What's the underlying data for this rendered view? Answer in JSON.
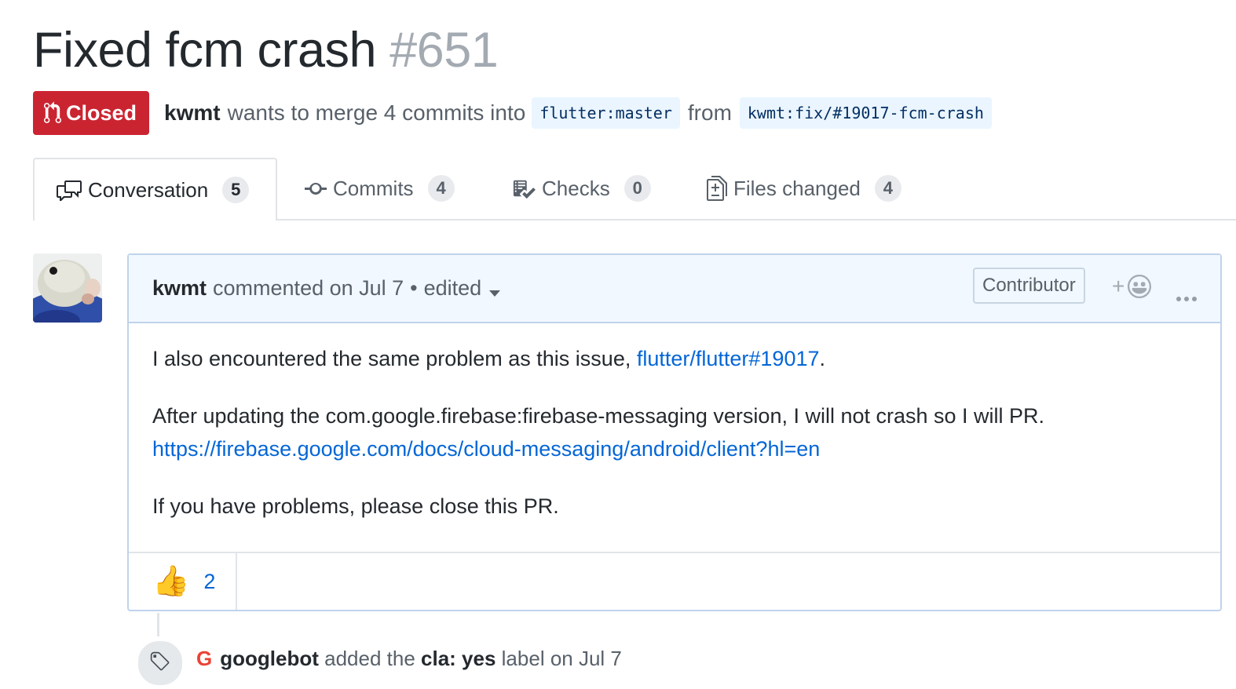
{
  "pr": {
    "title": "Fixed fcm crash",
    "number": "#651",
    "state": "Closed",
    "author": "kwmt",
    "merge_text": "wants to merge 4 commits into",
    "base_branch": "flutter:master",
    "from_word": "from",
    "head_branch": "kwmt:fix/#19017-fcm-crash"
  },
  "tabs": [
    {
      "label": "Conversation",
      "count": "5",
      "icon": "comment-discussion-icon"
    },
    {
      "label": "Commits",
      "count": "4",
      "icon": "git-commit-icon"
    },
    {
      "label": "Checks",
      "count": "0",
      "icon": "checklist-icon"
    },
    {
      "label": "Files changed",
      "count": "4",
      "icon": "diff-icon"
    }
  ],
  "comment": {
    "author": "kwmt",
    "commented_text": "commented on Jul 7",
    "separator": "•",
    "edited_label": "edited",
    "badge": "Contributor",
    "add_reaction": "+",
    "body": {
      "p1_text": "I also encountered the same problem as this issue, ",
      "p1_link": "flutter/flutter#19017",
      "p1_end": ".",
      "p2_text": "After updating the com.google.firebase:firebase-messaging version, I will not crash so I will PR.",
      "p2_link": "https://firebase.google.com/docs/cloud-messaging/android/client?hl=en",
      "p3_text": "If you have problems, please close this PR."
    },
    "reactions": [
      {
        "emoji": "👍",
        "count": "2"
      }
    ]
  },
  "event": {
    "logo": "G",
    "author": "googlebot",
    "action": "added the",
    "label": "cla: yes",
    "suffix": "label on Jul 7"
  },
  "colors": {
    "closed": "#cb2431",
    "link": "#0366d6",
    "header_bg": "#f1f8ff",
    "border": "#c0d3eb"
  }
}
